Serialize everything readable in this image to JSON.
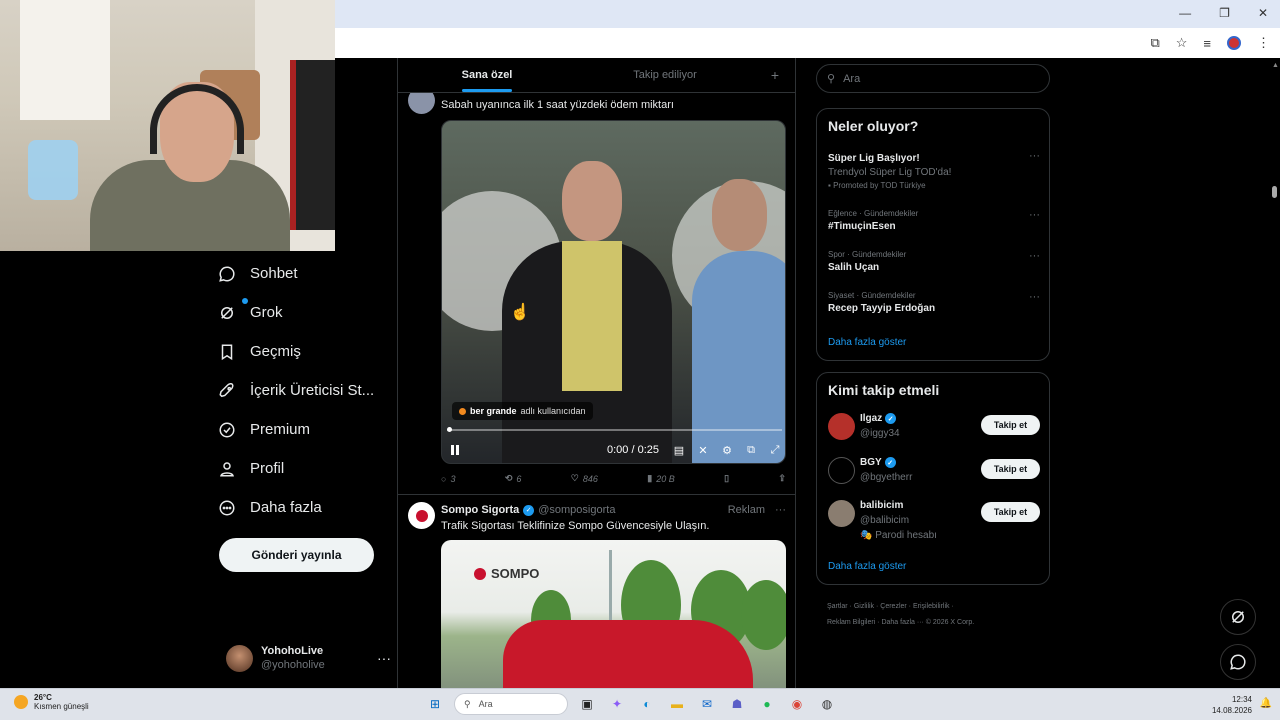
{
  "browser": {
    "controls": [
      "—",
      "❐",
      "✕"
    ],
    "toolbar_icons": [
      "install-app-icon",
      "star-icon",
      "media-icon",
      "profile-avatar-icon",
      "menu-icon"
    ]
  },
  "nav": {
    "items": [
      {
        "label": "Sohbet",
        "icon": "chat-icon"
      },
      {
        "label": "Grok",
        "icon": "grok-icon"
      },
      {
        "label": "Geçmiş",
        "icon": "bookmark-icon"
      },
      {
        "label": "İçerik Üreticisi St...",
        "icon": "rocket-icon"
      },
      {
        "label": "Premium",
        "icon": "verified-icon"
      },
      {
        "label": "Profil",
        "icon": "person-icon"
      },
      {
        "label": "Daha fazla",
        "icon": "more-circle-icon"
      }
    ],
    "post_button": "Gönderi yayınla"
  },
  "account": {
    "name": "YohohoLive",
    "handle": "@yohoholive",
    "more": "···"
  },
  "feed": {
    "tabs": [
      {
        "label": "Sana özel",
        "active": true
      },
      {
        "label": "Takip ediliyor",
        "active": false
      }
    ],
    "add_tab": "+",
    "tweet1": {
      "text": "Sabah uyanınca ilk 1 saat yüzdeki ödem miktarı",
      "video": {
        "source_label_user": "ber grande",
        "source_label_rest": "adlı kullanıcıdan",
        "time": "0:00 / 0:25",
        "progress": 0
      },
      "actions": {
        "replies": "3",
        "reposts": "6",
        "likes": "846",
        "views": "20 B"
      }
    },
    "tweet2": {
      "name": "Sompo Sigorta",
      "handle": "@somposigorta",
      "tag": "Reklam",
      "more": "···",
      "text": "Trafik Sigortası Teklifinize Sompo Güvencesiyle Ulaşın.",
      "image_logo": "SOMPO"
    }
  },
  "right": {
    "search_placeholder": "Ara",
    "trends": {
      "title": "Neler oluyor?",
      "items": [
        {
          "category": "",
          "name": "Süper Lig Başlıyor!",
          "sub": "Trendyol Süper Lig TOD'da!",
          "promo": "Promoted by TOD Türkiye"
        },
        {
          "category": "Eğlence · Gündemdekiler",
          "name": "#TimuçinEsen",
          "sub": "",
          "promo": ""
        },
        {
          "category": "Spor · Gündemdekiler",
          "name": "Salih Uçan",
          "sub": "",
          "promo": ""
        },
        {
          "category": "Siyaset · Gündemdekiler",
          "name": "Recep Tayyip Erdoğan",
          "sub": "",
          "promo": ""
        }
      ],
      "show_more": "Daha fazla göster"
    },
    "who_to_follow": {
      "title": "Kimi takip etmeli",
      "items": [
        {
          "name": "Ilgaz",
          "handle": "@iggy34",
          "verified": true,
          "extra": "",
          "button": "Takip et",
          "avatar_color": "#b5302a"
        },
        {
          "name": "BGY",
          "handle": "@bgyetherr",
          "verified": true,
          "extra": "",
          "button": "Takip et",
          "avatar_color": "#000000"
        },
        {
          "name": "balibicim",
          "handle": "@balibicim",
          "verified": false,
          "extra": "Parodi hesabı",
          "button": "Takip et",
          "avatar_color": "#8a7d70"
        }
      ],
      "show_more": "Daha fazla göster"
    },
    "footer": {
      "line1": "Şartlar · Gizlilik · Çerezler · Erişilebilirlik ·",
      "line2": "Reklam Bilgileri · Daha fazla ··· © 2026 X Corp."
    }
  },
  "taskbar": {
    "weather_temp": "26°C",
    "weather_desc": "Kısmen güneşli",
    "search": "Ara",
    "time": "12:34",
    "date": "14.08.2026"
  },
  "colors": {
    "accent": "#1d9bf0",
    "background": "#000000",
    "border": "#2f3336",
    "muted": "#71767b"
  }
}
